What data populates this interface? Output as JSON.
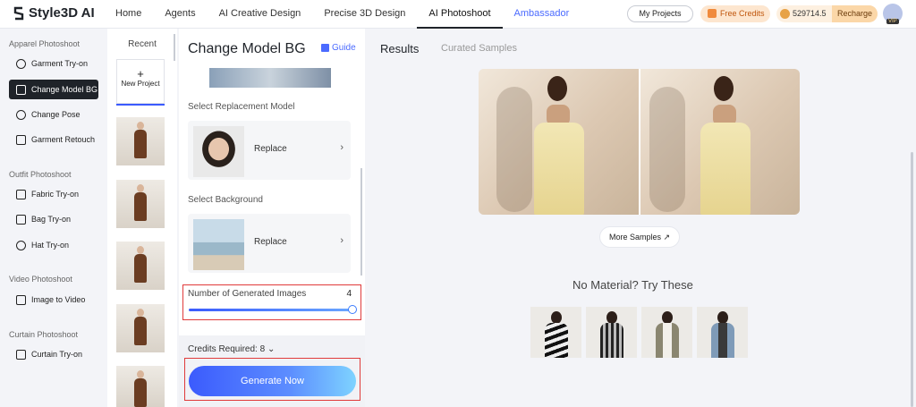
{
  "app": {
    "brand": "Style3D AI"
  },
  "nav": {
    "items": [
      "Home",
      "Agents",
      "AI Creative Design",
      "Precise 3D Design",
      "AI Photoshoot",
      "Ambassador"
    ],
    "active_index": 4
  },
  "header": {
    "my_projects": "My Projects",
    "free_credits": "Free Credits",
    "balance": "529714.5",
    "recharge": "Recharge",
    "vip": "VIP"
  },
  "sidebar": {
    "sections": [
      {
        "title": "Apparel Photoshoot",
        "items": [
          "Garment Try-on",
          "Change Model BG",
          "Change Pose",
          "Garment Retouch"
        ]
      },
      {
        "title": "Outfit Photoshoot",
        "items": [
          "Fabric Try-on",
          "Bag Try-on",
          "Hat Try-on"
        ]
      },
      {
        "title": "Video Photoshoot",
        "items": [
          "Image to Video"
        ]
      },
      {
        "title": "Curtain Photoshoot",
        "items": [
          "Curtain Try-on"
        ]
      }
    ],
    "active_item": "Change Model BG"
  },
  "recent": {
    "title": "Recent",
    "new_project_icon": "+",
    "new_project": "New Project"
  },
  "panel": {
    "title": "Change Model BG",
    "guide": "Guide",
    "select_model_label": "Select Replacement Model",
    "replace_model": "Replace",
    "select_background_label": "Select Background",
    "replace_background": "Replace",
    "chevron": "›",
    "num_images_label": "Number of Generated Images",
    "num_images_value": "4",
    "slider_fraction": 1.0,
    "credits_required": "Credits Required: 8",
    "credits_chevron": "⌄",
    "generate_button": "Generate Now"
  },
  "results": {
    "tab_results": "Results",
    "tab_curated": "Curated Samples",
    "more_samples": "More Samples",
    "more_samples_icon": "↗",
    "no_material": "No Material? Try These"
  },
  "colors": {
    "accent": "#3b5bfd",
    "highlight_box": "#e03a3a",
    "ambassador": "#4b6bff"
  }
}
